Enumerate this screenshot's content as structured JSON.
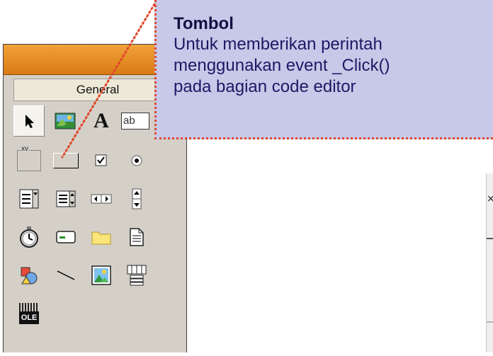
{
  "toolbox": {
    "tab_label": "General",
    "tools": [
      {
        "name": "pointer-tool-icon"
      },
      {
        "name": "picturebox-tool-icon"
      },
      {
        "name": "label-tool-icon",
        "glyph": "A"
      },
      {
        "name": "textbox-tool-icon",
        "glyph": "ab"
      },
      {
        "name": "frame-tool-icon",
        "glyph": "xv"
      },
      {
        "name": "commandbutton-tool-icon"
      },
      {
        "name": "checkbox-tool-icon"
      },
      {
        "name": "optionbutton-tool-icon"
      },
      {
        "name": "combobox-tool-icon"
      },
      {
        "name": "listbox-tool-icon"
      },
      {
        "name": "hscrollbar-tool-icon"
      },
      {
        "name": "vscrollbar-tool-icon"
      },
      {
        "name": "timer-tool-icon"
      },
      {
        "name": "drivelistbox-tool-icon"
      },
      {
        "name": "dirlistbox-tool-icon"
      },
      {
        "name": "filelistbox-tool-icon"
      },
      {
        "name": "shape-tool-icon"
      },
      {
        "name": "line-tool-icon"
      },
      {
        "name": "image-tool-icon"
      },
      {
        "name": "data-tool-icon"
      },
      {
        "name": "ole-tool-icon",
        "glyph": "OLE"
      }
    ]
  },
  "callout": {
    "title": "Tombol",
    "lines": [
      "Untuk memberikan perintah",
      "menggunakan event  _Click()",
      "pada bagian code editor"
    ]
  },
  "colors": {
    "titlebar": "#e08a1e",
    "callout_bg": "#c8c8e8",
    "callout_border": "#e0482c",
    "toolbox_bg": "#d4d0c8"
  }
}
